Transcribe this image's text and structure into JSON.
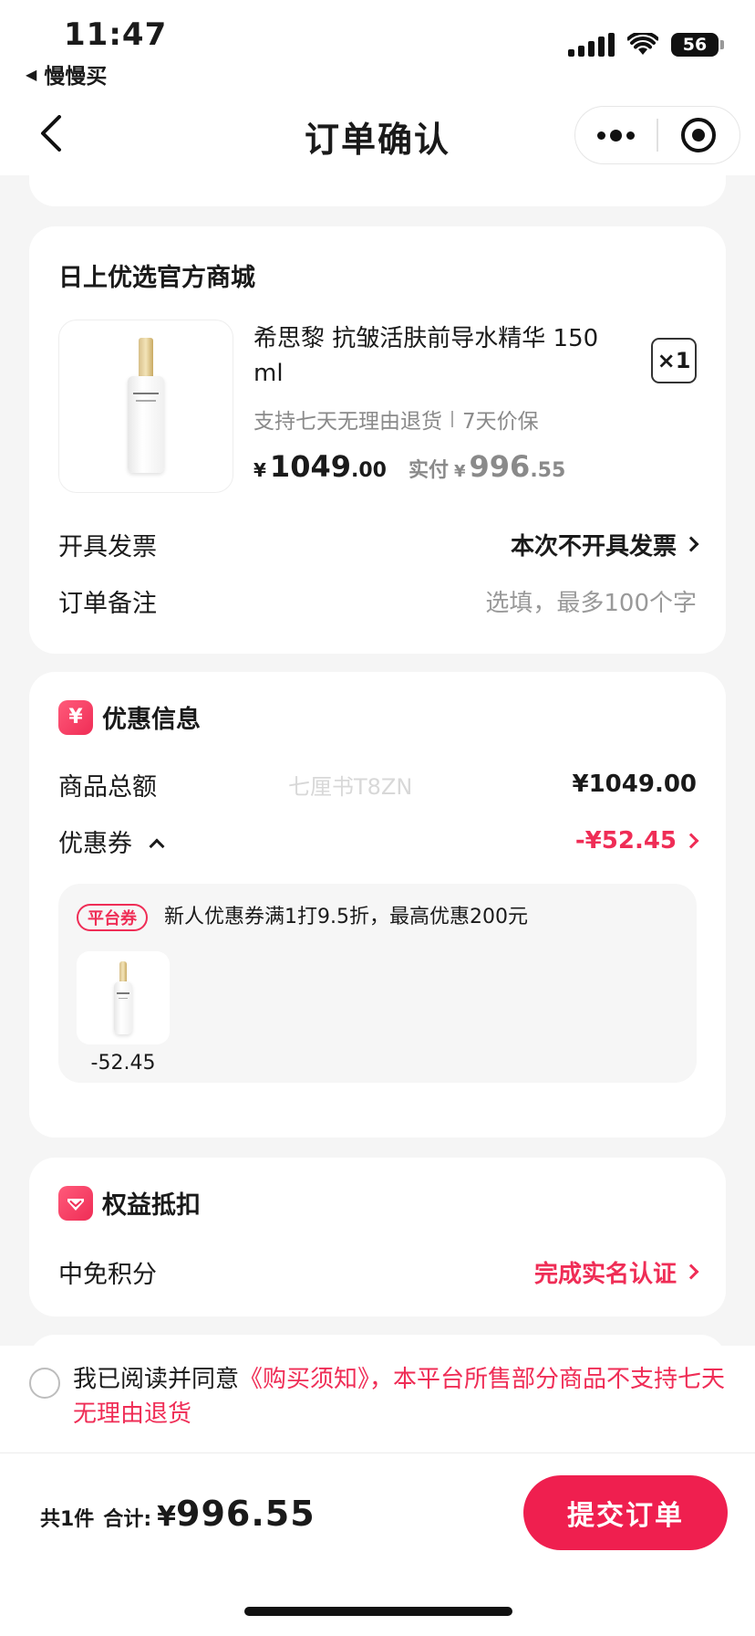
{
  "status_bar": {
    "time": "11:47",
    "back_app": "慢慢买",
    "battery": "56"
  },
  "nav": {
    "title": "订单确认"
  },
  "store": {
    "name": "日上优选官方商城",
    "product": {
      "title": "希思黎 抗皱活肤前导水精华 150ml",
      "quantity": "×1",
      "tag_return": "支持七天无理由退货",
      "tag_price": "7天价保",
      "price_symbol": "¥",
      "price_int": "1049",
      "price_dec": ".00",
      "actual_label": "实付",
      "actual_symbol": "¥",
      "actual_int": "996",
      "actual_dec": ".55"
    },
    "invoice": {
      "label": "开具发票",
      "value": "本次不开具发票"
    },
    "remark": {
      "label": "订单备注",
      "placeholder": "选填，最多100个字"
    }
  },
  "discount": {
    "badge": "¥",
    "title": "优惠信息",
    "watermark": "七厘书T8ZN",
    "total_label": "商品总额",
    "total_value": "¥1049.00",
    "coupon_label": "优惠券",
    "coupon_value": "-¥52.45",
    "coupon_detail": {
      "tag": "平台券",
      "desc": "新人优惠券满1打9.5折，最高优惠200元",
      "amount": "-52.45"
    }
  },
  "benefit": {
    "title": "权益抵扣",
    "points_label": "中免积分",
    "points_action": "完成实名认证"
  },
  "agreement": {
    "prefix": "我已阅读并同意",
    "link_text": "《购买须知》，本平台所售部分商品不支持七天无理由退货"
  },
  "footer": {
    "count_text": "共1件",
    "sum_label": "合计:",
    "currency": "¥",
    "total": "996.55",
    "submit_label": "提交订单"
  },
  "colors": {
    "accent": "#ef2d56",
    "submit": "#ef1f4f",
    "muted": "#8a8a8a"
  },
  "icons": [
    "back-arrow-icon",
    "more-dots-icon",
    "target-icon",
    "chevron-right-icon",
    "chevron-up-icon",
    "yen-badge-icon",
    "benefit-heart-icon",
    "signal-icon",
    "wifi-icon",
    "battery-icon"
  ]
}
